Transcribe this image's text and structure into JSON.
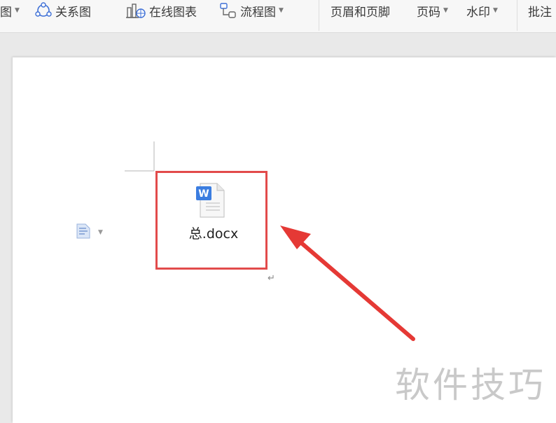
{
  "toolbar": {
    "items": [
      {
        "label": "图",
        "icon": "none",
        "dropdown": true
      },
      {
        "label": "关系图",
        "icon": "relationship-icon",
        "dropdown": false
      },
      {
        "label": "在线图表",
        "icon": "chart-icon",
        "dropdown": false
      },
      {
        "label": "流程图",
        "icon": "flowchart-icon",
        "dropdown": true
      },
      {
        "label": "页眉和页脚",
        "icon": "none",
        "dropdown": false
      },
      {
        "label": "页码",
        "icon": "none",
        "dropdown": true
      },
      {
        "label": "水印",
        "icon": "none",
        "dropdown": true
      },
      {
        "label": "批注",
        "icon": "none",
        "dropdown": false
      }
    ]
  },
  "document": {
    "embedded_file": {
      "name": "总.docx",
      "icon": "word-document-icon",
      "icon_letter": "W"
    },
    "paragraph_mark": "↵"
  },
  "annotation": {
    "box_color": "#e24b4b",
    "arrow_color": "#e53935"
  },
  "watermark": {
    "text": "软件技巧"
  }
}
